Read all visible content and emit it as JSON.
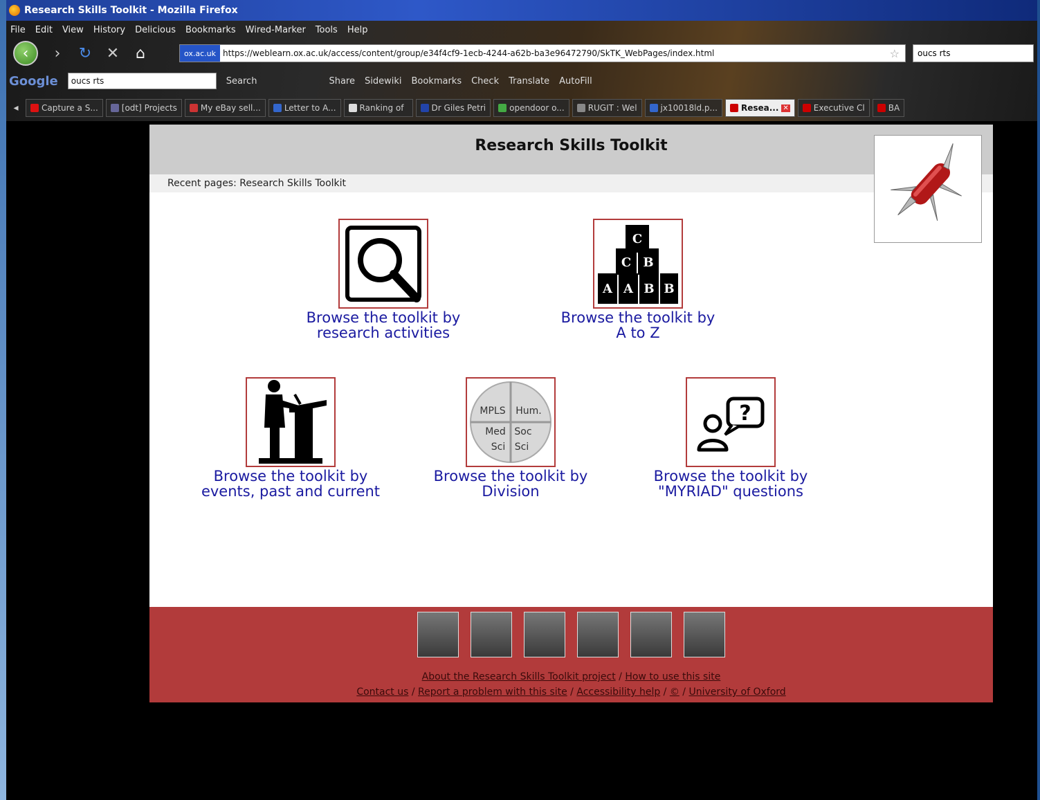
{
  "window": {
    "title": "Research Skills Toolkit - Mozilla Firefox"
  },
  "menu": [
    "File",
    "Edit",
    "View",
    "History",
    "Delicious",
    "Bookmarks",
    "Wired-Marker",
    "Tools",
    "Help"
  ],
  "nav": {
    "site_badge": "ox.ac.uk",
    "url": "https://weblearn.ox.ac.uk/access/content/group/e34f4cf9-1ecb-4244-a62b-ba3e96472790/SkTK_WebPages/index.html",
    "search_value": "oucs rts"
  },
  "google_toolbar": {
    "logo": "Google",
    "query": "oucs rts",
    "buttons": [
      "Search",
      "Share",
      "Sidewiki",
      "Bookmarks",
      "Check",
      "Translate",
      "AutoFill"
    ]
  },
  "tabs": [
    {
      "label": "Capture a S...",
      "color": "#d11"
    },
    {
      "label": "[odt] Projects",
      "color": "#669"
    },
    {
      "label": "My eBay sell...",
      "color": "#c33"
    },
    {
      "label": "Letter to A...",
      "color": "#36c"
    },
    {
      "label": "Ranking of",
      "color": "#ddd"
    },
    {
      "label": "Dr Giles Petri",
      "color": "#24a"
    },
    {
      "label": "opendoor o...",
      "color": "#4a4"
    },
    {
      "label": "RUGIT : Wel",
      "color": "#888"
    },
    {
      "label": "jx10018ld.p...",
      "color": "#36c"
    },
    {
      "label": "Resea...",
      "color": "#c00",
      "active": true
    },
    {
      "label": "Executive Cl",
      "color": "#c00"
    },
    {
      "label": "BA",
      "color": "#c00"
    }
  ],
  "page": {
    "title": "Research Skills Toolkit",
    "recent_label": "Recent pages:",
    "recent_value": "Research Skills Toolkit",
    "tiles": [
      {
        "line1": "Browse the toolkit by",
        "line2": "research activities"
      },
      {
        "line1": "Browse the toolkit by",
        "line2": "A to Z"
      },
      {
        "line1": "Browse the toolkit by",
        "line2": "events, past and current"
      },
      {
        "line1": "Browse the toolkit by",
        "line2": "Division"
      },
      {
        "line1": "Browse the toolkit by",
        "line2": "\"MYRIAD\" questions"
      }
    ],
    "division_icon": {
      "q1": "MPLS",
      "q2": "Hum.",
      "q3a": "Med",
      "q3b": "Sci",
      "q4a": "Soc",
      "q4b": "Sci"
    },
    "az_blocks": [
      "C",
      "C",
      "A",
      "B",
      "A",
      "A",
      "B",
      "B"
    ],
    "footer": {
      "links_row1": [
        "About the Research Skills Toolkit project",
        "How to use this site"
      ],
      "links_row2": [
        "Contact us",
        "Report a problem with this site",
        "Accessibility help",
        "©",
        "University of Oxford"
      ]
    }
  }
}
